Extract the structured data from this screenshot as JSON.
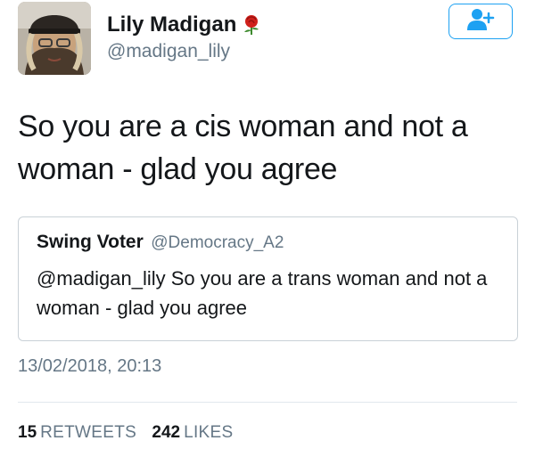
{
  "tweet": {
    "author": {
      "name": "Lily Madigan",
      "handle": "@madigan_lily",
      "name_emoji": "rose-icon"
    },
    "text": "So you are a cis woman and not a woman - glad you agree",
    "timestamp": "13/02/2018, 20:13"
  },
  "follow_button": {
    "icon": "add-user-icon",
    "color": "#1da1f2"
  },
  "quoted_tweet": {
    "author_name": "Swing Voter",
    "author_handle": "@Democracy_A2",
    "text": "@madigan_lily So you are a trans woman and not a woman - glad you agree"
  },
  "stats": {
    "retweets_count": "15",
    "retweets_label": "RETWEETS",
    "likes_count": "242",
    "likes_label": "LIKES"
  },
  "colors": {
    "text_primary": "#14171a",
    "text_secondary": "#657786",
    "accent": "#1da1f2",
    "border": "#c9d1d7"
  }
}
